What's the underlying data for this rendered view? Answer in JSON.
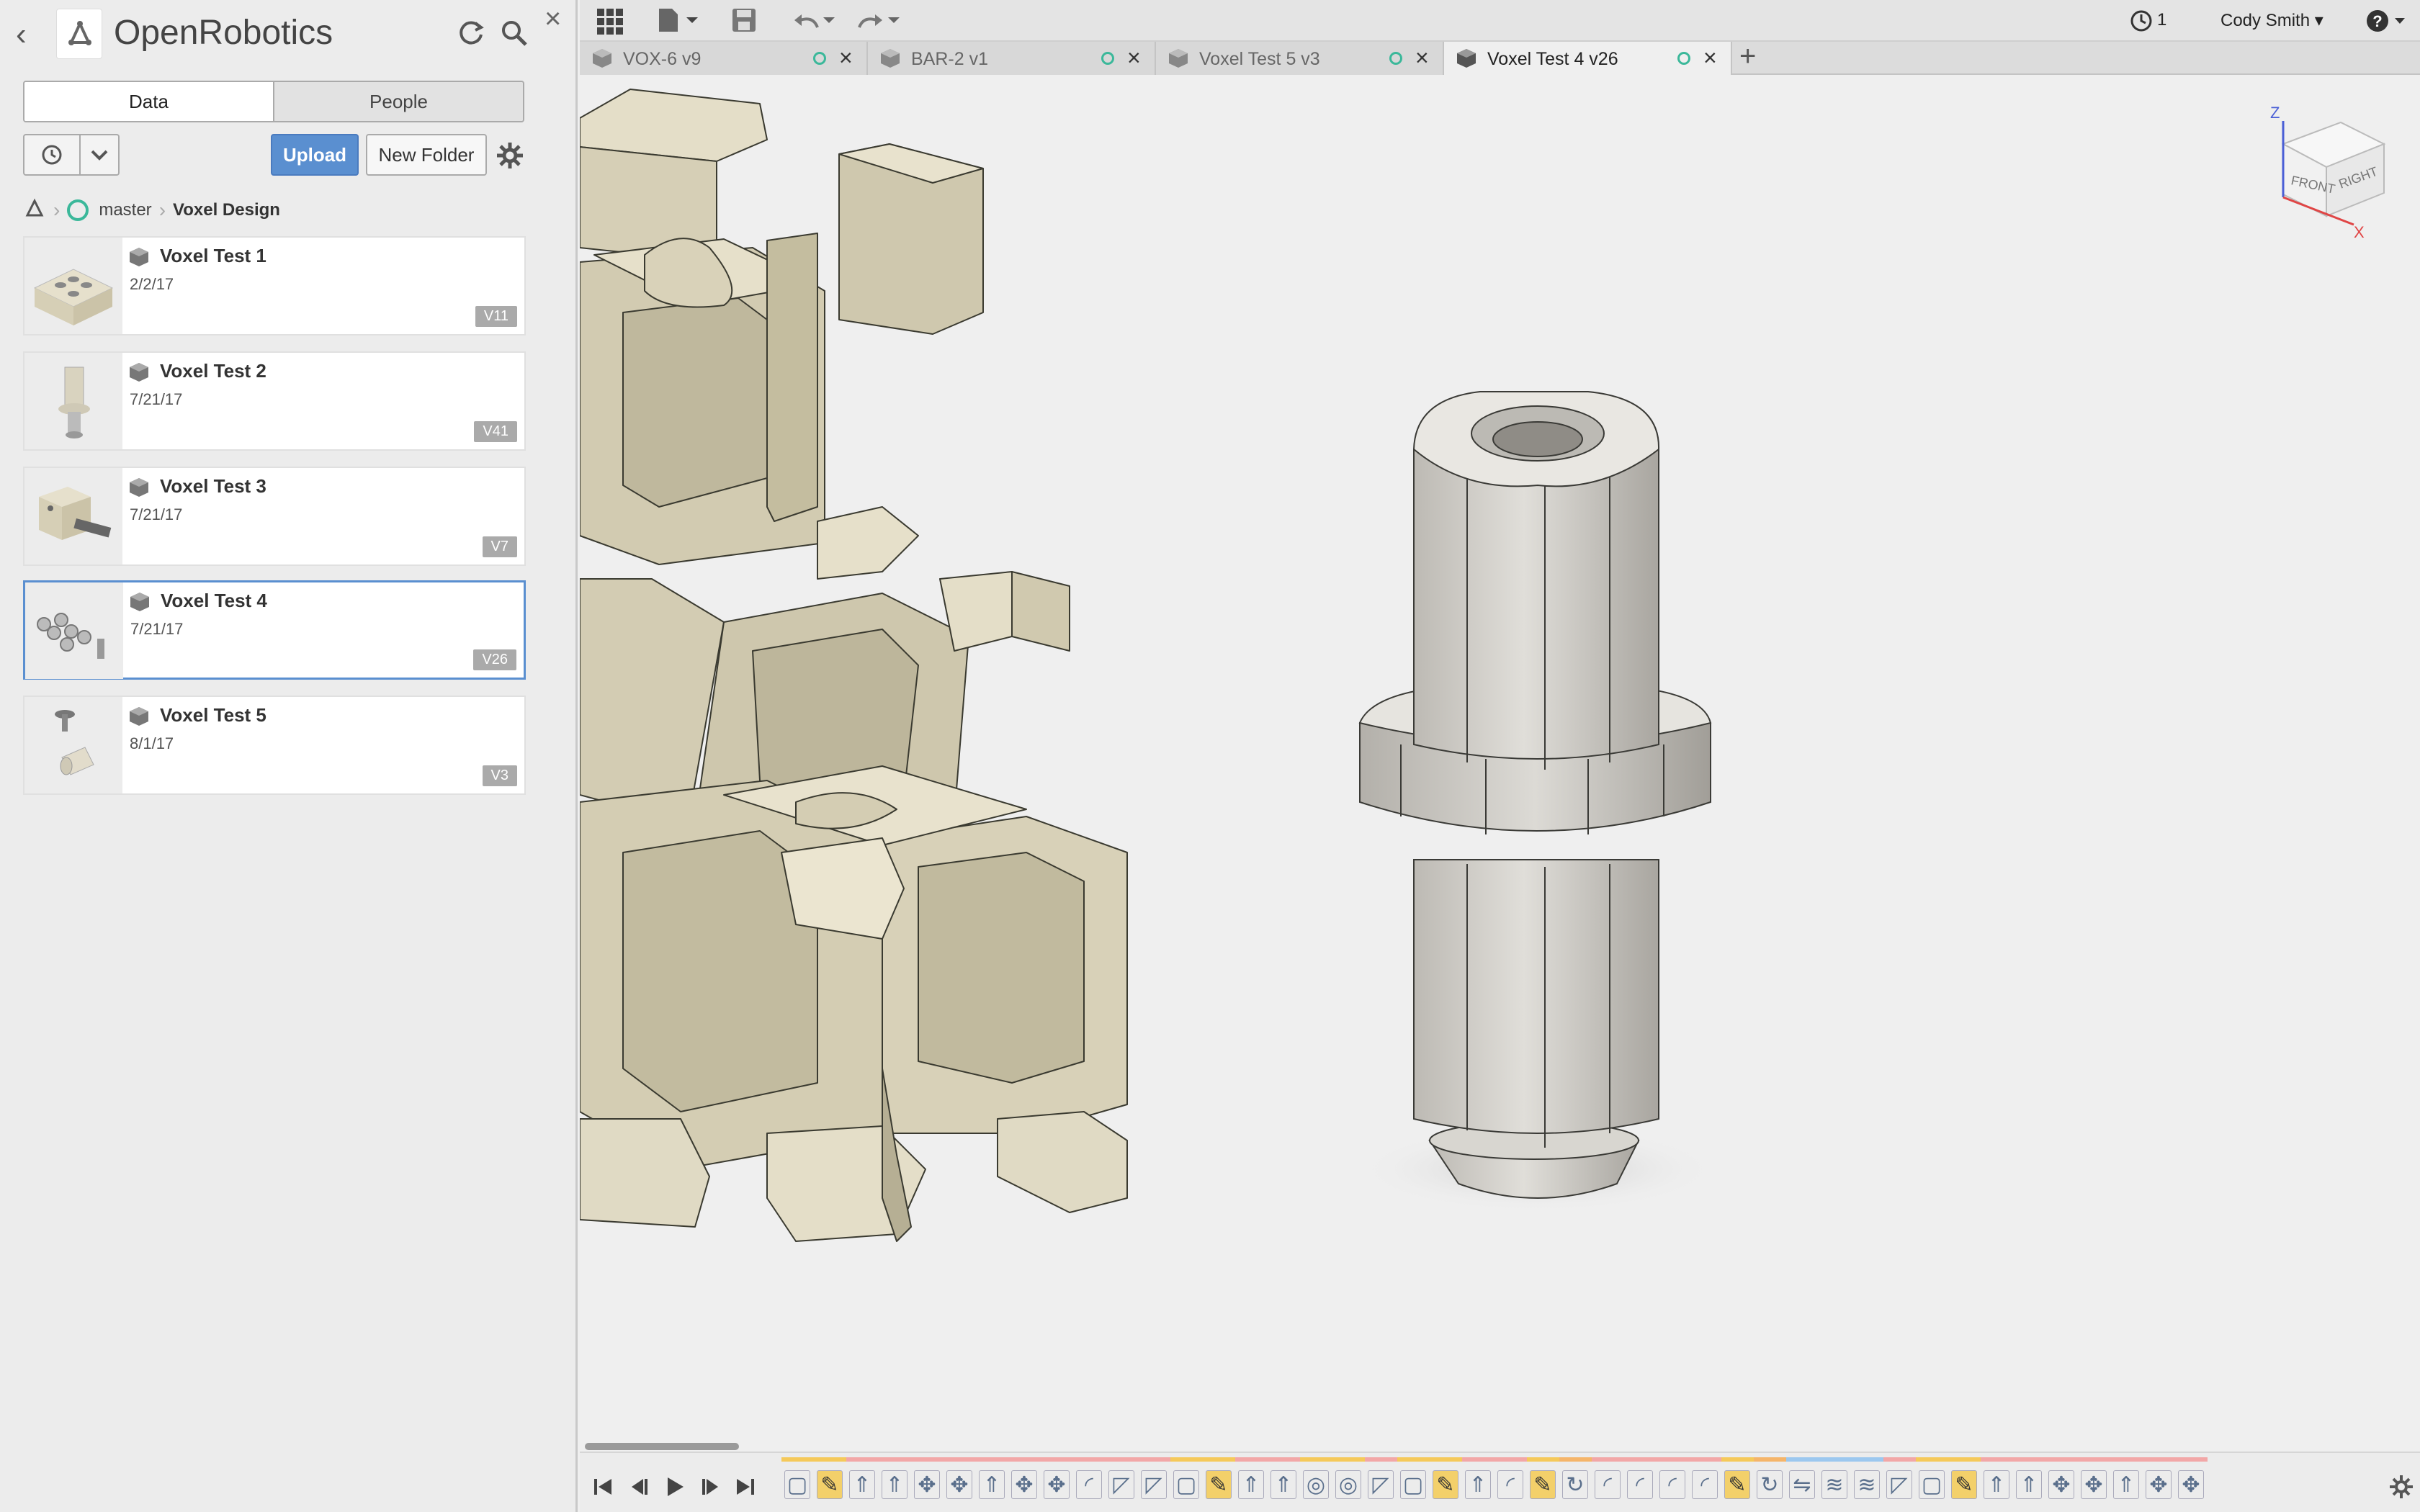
{
  "app": {
    "project_name": "OpenRobotics",
    "user_name": "Cody Smith",
    "jobs_count": "1"
  },
  "panel": {
    "tabs": {
      "data": "Data",
      "people": "People"
    },
    "upload_label": "Upload",
    "new_folder_label": "New Folder",
    "breadcrumb": {
      "branch": "master",
      "folder": "Voxel Design"
    },
    "files": [
      {
        "name": "Voxel Test 1",
        "date": "2/2/17",
        "version": "V11"
      },
      {
        "name": "Voxel Test 2",
        "date": "7/21/17",
        "version": "V41"
      },
      {
        "name": "Voxel Test 3",
        "date": "7/21/17",
        "version": "V7"
      },
      {
        "name": "Voxel Test 4",
        "date": "7/21/17",
        "version": "V26"
      },
      {
        "name": "Voxel Test 5",
        "date": "8/1/17",
        "version": "V3"
      }
    ]
  },
  "doc_tabs": [
    {
      "label": "VOX-6 v9"
    },
    {
      "label": "BAR-2 v1"
    },
    {
      "label": "Voxel Test 5 v3"
    },
    {
      "label": "Voxel Test 4 v26"
    }
  ],
  "viewcube": {
    "front": "FRONT",
    "right": "RIGHT",
    "axis_z": "Z",
    "axis_x": "X"
  },
  "colors": {
    "accent": "#5a8fd0",
    "status_ok": "#3bb89a",
    "model": "#e3dcc6",
    "metal": "#c9c7c2"
  },
  "timeline": {
    "feature_icons": [
      "box",
      "sketch",
      "extrude",
      "extrude",
      "move",
      "move",
      "extrude",
      "move",
      "move",
      "fillet",
      "chamfer",
      "chamfer",
      "box",
      "sketch",
      "extrude",
      "extrude",
      "hole",
      "hole",
      "chamfer",
      "box",
      "sketch",
      "extrude",
      "fillet",
      "sketch",
      "revolve",
      "fillet",
      "fillet",
      "fillet",
      "fillet",
      "sketch",
      "revolve",
      "mirror",
      "thread",
      "thread",
      "chamfer",
      "box",
      "sketch",
      "extrude",
      "extrude",
      "move",
      "move",
      "extrude",
      "move",
      "move"
    ]
  }
}
